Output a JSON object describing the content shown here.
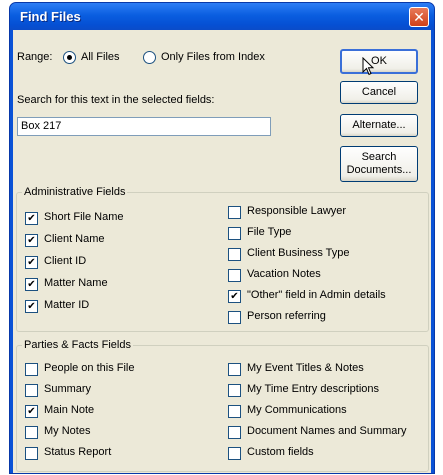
{
  "dialog": {
    "title": "Find Files",
    "close_glyph": "✕"
  },
  "range": {
    "label": "Range:",
    "options": [
      {
        "label": "All Files",
        "selected": true
      },
      {
        "label": "Only Files from Index",
        "selected": false
      }
    ]
  },
  "search": {
    "label": "Search for this text in the selected fields:",
    "value": "Box 217"
  },
  "buttons": {
    "ok": "OK",
    "cancel": "Cancel",
    "alternate": "Alternate...",
    "search_documents_line1": "Search",
    "search_documents_line2": "Documents..."
  },
  "admin": {
    "legend": "Administrative Fields",
    "left": [
      {
        "label": "Short File Name",
        "checked": true
      },
      {
        "label": "Client Name",
        "checked": true
      },
      {
        "label": "Client ID",
        "checked": true
      },
      {
        "label": "Matter Name",
        "checked": true
      },
      {
        "label": "Matter ID",
        "checked": true
      }
    ],
    "right": [
      {
        "label": "Responsible Lawyer",
        "checked": false
      },
      {
        "label": "File Type",
        "checked": false
      },
      {
        "label": "Client Business Type",
        "checked": false
      },
      {
        "label": "Vacation Notes",
        "checked": false
      },
      {
        "label": "\"Other\" field in Admin details",
        "checked": true
      },
      {
        "label": "Person referring",
        "checked": false
      }
    ]
  },
  "parties": {
    "legend": "Parties & Facts Fields",
    "left": [
      {
        "label": "People on this File",
        "checked": false
      },
      {
        "label": "Summary",
        "checked": false
      },
      {
        "label": "Main Note",
        "checked": true
      },
      {
        "label": "My Notes",
        "checked": false
      },
      {
        "label": "Status Report",
        "checked": false
      }
    ],
    "right": [
      {
        "label": "My Event Titles & Notes",
        "checked": false
      },
      {
        "label": "My Time Entry descriptions",
        "checked": false
      },
      {
        "label": "My Communications",
        "checked": false
      },
      {
        "label": "Document Names and Summary",
        "checked": false
      },
      {
        "label": "Custom fields",
        "checked": false
      }
    ]
  },
  "check_glyph": "✔"
}
